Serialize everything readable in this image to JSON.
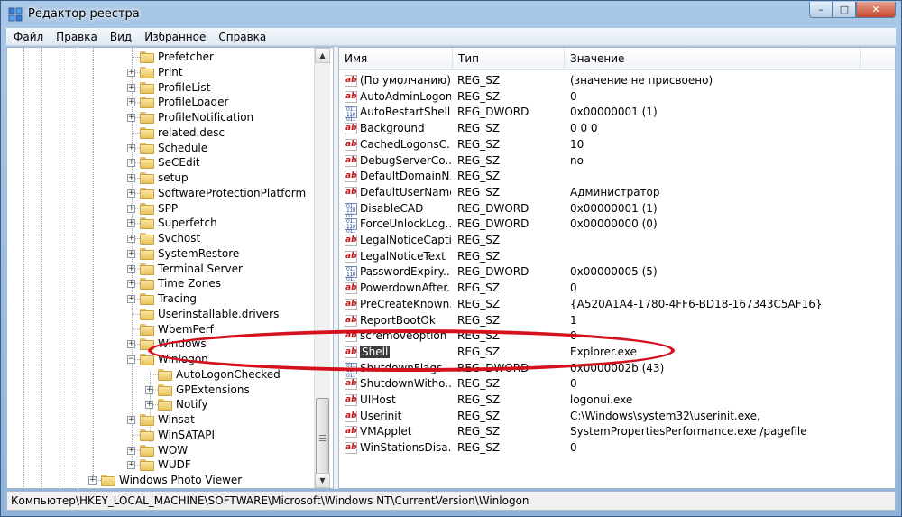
{
  "window": {
    "title": "Редактор реестра",
    "buttons": {
      "minimize": "–",
      "maximize": "□",
      "close": "✕"
    }
  },
  "menu": [
    {
      "label": "Файл",
      "key": "Ф",
      "rest": "айл"
    },
    {
      "label": "Правка",
      "key": "П",
      "rest": "равка"
    },
    {
      "label": "Вид",
      "key": "В",
      "rest": "ид"
    },
    {
      "label": "Избранное",
      "key": "И",
      "rest": "збранное"
    },
    {
      "label": "Справка",
      "key": "С",
      "rest": "правка"
    }
  ],
  "tree": [
    {
      "label": "Prefetcher",
      "level": 1,
      "expander": "none"
    },
    {
      "label": "Print",
      "level": 1,
      "expander": "plus"
    },
    {
      "label": "ProfileList",
      "level": 1,
      "expander": "plus"
    },
    {
      "label": "ProfileLoader",
      "level": 1,
      "expander": "plus"
    },
    {
      "label": "ProfileNotification",
      "level": 1,
      "expander": "plus"
    },
    {
      "label": "related.desc",
      "level": 1,
      "expander": "none"
    },
    {
      "label": "Schedule",
      "level": 1,
      "expander": "plus"
    },
    {
      "label": "SeCEdit",
      "level": 1,
      "expander": "plus"
    },
    {
      "label": "setup",
      "level": 1,
      "expander": "plus"
    },
    {
      "label": "SoftwareProtectionPlatform",
      "level": 1,
      "expander": "plus"
    },
    {
      "label": "SPP",
      "level": 1,
      "expander": "plus"
    },
    {
      "label": "Superfetch",
      "level": 1,
      "expander": "plus"
    },
    {
      "label": "Svchost",
      "level": 1,
      "expander": "plus"
    },
    {
      "label": "SystemRestore",
      "level": 1,
      "expander": "plus"
    },
    {
      "label": "Terminal Server",
      "level": 1,
      "expander": "plus"
    },
    {
      "label": "Time Zones",
      "level": 1,
      "expander": "plus"
    },
    {
      "label": "Tracing",
      "level": 1,
      "expander": "plus"
    },
    {
      "label": "Userinstallable.drivers",
      "level": 1,
      "expander": "none"
    },
    {
      "label": "WbemPerf",
      "level": 1,
      "expander": "none"
    },
    {
      "label": "Windows",
      "level": 1,
      "expander": "plus"
    },
    {
      "label": "Winlogon",
      "level": 1,
      "expander": "minus",
      "open": true
    },
    {
      "label": "AutoLogonChecked",
      "level": 2,
      "expander": "none"
    },
    {
      "label": "GPExtensions",
      "level": 2,
      "expander": "plus"
    },
    {
      "label": "Notify",
      "level": 2,
      "expander": "plus"
    },
    {
      "label": "Winsat",
      "level": 1,
      "expander": "plus"
    },
    {
      "label": "WinSATAPI",
      "level": 1,
      "expander": "none"
    },
    {
      "label": "WOW",
      "level": 1,
      "expander": "plus"
    },
    {
      "label": "WUDF",
      "level": 1,
      "expander": "plus"
    },
    {
      "label": "Windows Photo Viewer",
      "level": 0,
      "expander": "plus"
    }
  ],
  "columns": {
    "name": "Имя",
    "type": "Тип",
    "value": "Значение"
  },
  "values": [
    {
      "name": "(По умолчанию)",
      "type": "REG_SZ",
      "data": "(значение не присвоено)",
      "icon": "ab"
    },
    {
      "name": "AutoAdminLogon",
      "type": "REG_SZ",
      "data": "0",
      "icon": "ab"
    },
    {
      "name": "AutoRestartShell",
      "type": "REG_DWORD",
      "data": "0x00000001 (1)",
      "icon": "bin"
    },
    {
      "name": "Background",
      "type": "REG_SZ",
      "data": "0 0 0",
      "icon": "ab"
    },
    {
      "name": "CachedLogonsC...",
      "type": "REG_SZ",
      "data": "10",
      "icon": "ab"
    },
    {
      "name": "DebugServerCo...",
      "type": "REG_SZ",
      "data": "no",
      "icon": "ab"
    },
    {
      "name": "DefaultDomainN...",
      "type": "REG_SZ",
      "data": "",
      "icon": "ab"
    },
    {
      "name": "DefaultUserName",
      "type": "REG_SZ",
      "data": "Администратор",
      "icon": "ab"
    },
    {
      "name": "DisableCAD",
      "type": "REG_DWORD",
      "data": "0x00000001 (1)",
      "icon": "bin"
    },
    {
      "name": "ForceUnlockLog...",
      "type": "REG_DWORD",
      "data": "0x00000000 (0)",
      "icon": "bin"
    },
    {
      "name": "LegalNoticeCapti...",
      "type": "REG_SZ",
      "data": "",
      "icon": "ab"
    },
    {
      "name": "LegalNoticeText",
      "type": "REG_SZ",
      "data": "",
      "icon": "ab"
    },
    {
      "name": "PasswordExpiry...",
      "type": "REG_DWORD",
      "data": "0x00000005 (5)",
      "icon": "bin"
    },
    {
      "name": "PowerdownAfter...",
      "type": "REG_SZ",
      "data": "0",
      "icon": "ab"
    },
    {
      "name": "PreCreateKnown...",
      "type": "REG_SZ",
      "data": "{A520A1A4-1780-4FF6-BD18-167343C5AF16}",
      "icon": "ab"
    },
    {
      "name": "ReportBootOk",
      "type": "REG_SZ",
      "data": "1",
      "icon": "ab"
    },
    {
      "name": "scremoveoption",
      "type": "REG_SZ",
      "data": "0",
      "icon": "ab"
    },
    {
      "name": "Shell",
      "type": "REG_SZ",
      "data": "Explorer.exe",
      "icon": "ab",
      "selected": true
    },
    {
      "name": "ShutdownFlags",
      "type": "REG_DWORD",
      "data": "0x0000002b (43)",
      "icon": "bin"
    },
    {
      "name": "ShutdownWitho...",
      "type": "REG_SZ",
      "data": "0",
      "icon": "ab"
    },
    {
      "name": "UIHost",
      "type": "REG_SZ",
      "data": "logonui.exe",
      "icon": "ab"
    },
    {
      "name": "Userinit",
      "type": "REG_SZ",
      "data": "C:\\Windows\\system32\\userinit.exe,",
      "icon": "ab"
    },
    {
      "name": "VMApplet",
      "type": "REG_SZ",
      "data": "SystemPropertiesPerformance.exe /pagefile",
      "icon": "ab"
    },
    {
      "name": "WinStationsDisa...",
      "type": "REG_SZ",
      "data": "0",
      "icon": "ab"
    }
  ],
  "status": "Компьютер\\HKEY_LOCAL_MACHINE\\SOFTWARE\\Microsoft\\Windows NT\\CurrentVersion\\Winlogon",
  "colors": {
    "annotation": "#d4111c",
    "selection": "#3c3c3c"
  }
}
